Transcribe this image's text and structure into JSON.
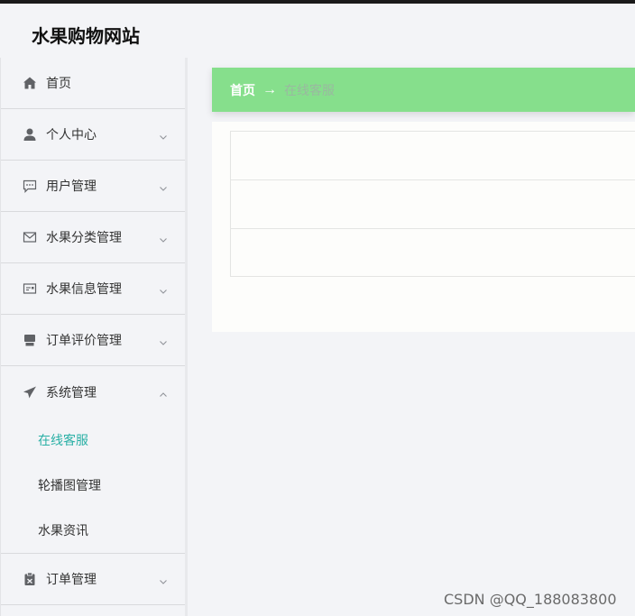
{
  "header": {
    "title": "水果购物网站"
  },
  "sidebar": {
    "items": [
      {
        "label": "首页",
        "icon": "home-icon"
      },
      {
        "label": "个人中心",
        "icon": "user-icon"
      },
      {
        "label": "用户管理",
        "icon": "chat-icon"
      },
      {
        "label": "水果分类管理",
        "icon": "mail-icon"
      },
      {
        "label": "水果信息管理",
        "icon": "message-card-icon"
      },
      {
        "label": "订单评价管理",
        "icon": "printer-icon"
      },
      {
        "label": "系统管理",
        "icon": "send-icon"
      }
    ],
    "system_sub": [
      {
        "label": "在线客服",
        "active": true
      },
      {
        "label": "轮播图管理"
      },
      {
        "label": "水果资讯"
      }
    ],
    "after": [
      {
        "label": "订单管理",
        "icon": "clipboard-icon"
      }
    ]
  },
  "breadcrumb": {
    "home": "首页",
    "separator": "→",
    "current": "在线客服"
  },
  "watermark": "CSDN @QQ_188083800",
  "colors": {
    "accent": "#86df8c",
    "active_text": "#2ab0a6",
    "background": "#f3f4f7"
  }
}
